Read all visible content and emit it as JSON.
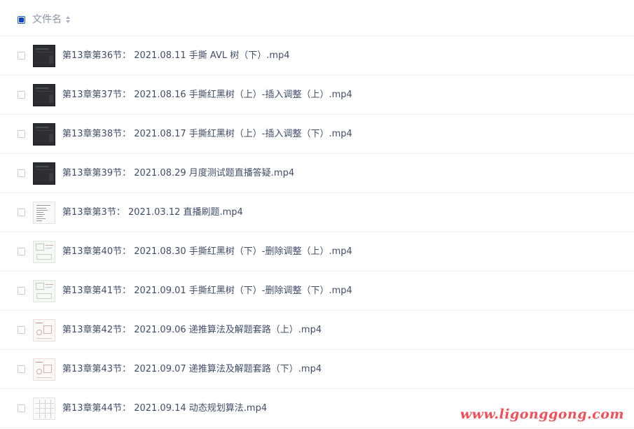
{
  "header": {
    "column_title": "文件名",
    "sort_icon": "sort-updown-icon"
  },
  "files": [
    {
      "name": "第13章第36节： 2021.08.11 手撕 AVL 树（下）.mp4",
      "thumb": "dark"
    },
    {
      "name": "第13章第37节： 2021.08.16 手撕红黑树（上）-插入调整（上）.mp4",
      "thumb": "dark"
    },
    {
      "name": "第13章第38节： 2021.08.17 手撕红黑树（上）-插入调整（下）.mp4",
      "thumb": "dark"
    },
    {
      "name": "第13章第39节： 2021.08.29 月度测试题直播答疑.mp4",
      "thumb": "dark"
    },
    {
      "name": "第13章第3节： 2021.03.12 直播刷题.mp4",
      "thumb": "doc"
    },
    {
      "name": "第13章第40节： 2021.08.30 手撕红黑树（下）-删除调整（上）.mp4",
      "thumb": "slide"
    },
    {
      "name": "第13章第41节： 2021.09.01 手撕红黑树（下）-删除调整（下）.mp4",
      "thumb": "slide"
    },
    {
      "name": "第13章第42节： 2021.09.06 递推算法及解题套路（上）.mp4",
      "thumb": "sketch"
    },
    {
      "name": "第13章第43节： 2021.09.07 递推算法及解题套路（下）.mp4",
      "thumb": "sketch"
    },
    {
      "name": "第13章第44节： 2021.09.14 动态规划算法.mp4",
      "thumb": "grid"
    }
  ],
  "watermark": "www.ligonggong.com",
  "colors": {
    "accent": "#0a40c8",
    "text": "#424e67",
    "muted": "#8b93a3",
    "watermark": "#f1505a"
  }
}
